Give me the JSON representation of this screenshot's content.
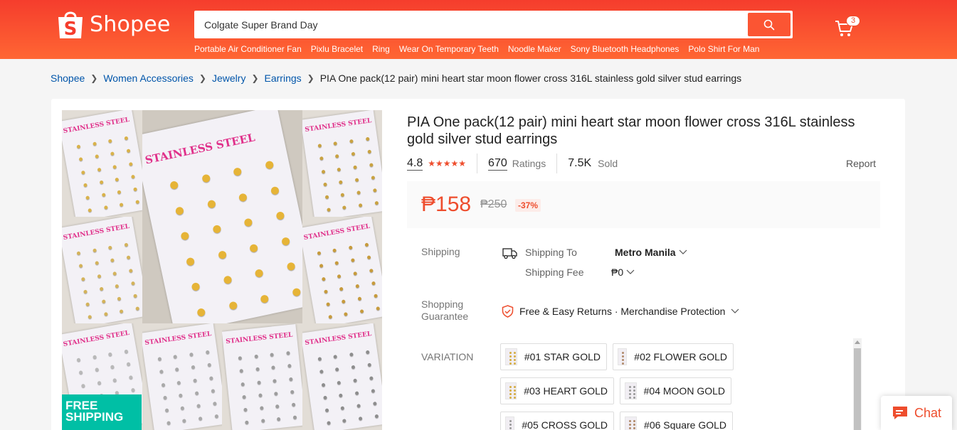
{
  "header": {
    "logo_text": "Shopee",
    "search_value": "Colgate Super Brand Day",
    "cart_count": "3",
    "suggestions": [
      "Portable Air Conditioner Fan",
      "Pixlu Bracelet",
      "Ring",
      "Wear On Temporary Teeth",
      "Noodle Maker",
      "Sony Bluetooth Headphones",
      "Polo Shirt For Man"
    ]
  },
  "breadcrumb": {
    "items": [
      "Shopee",
      "Women Accessories",
      "Jewelry",
      "Earrings"
    ],
    "current": "PIA One pack(12 pair) mini heart star moon flower cross 316L stainless gold silver stud earrings"
  },
  "gallery": {
    "board_label": "STAINLESS STEEL",
    "badge_line1": "FREE",
    "badge_line2": "SHIPPING"
  },
  "product": {
    "title": "PIA One pack(12 pair) mini heart star moon flower cross 316L stainless gold silver stud earrings",
    "rating": "4.8",
    "stars": 5,
    "ratings_count": "670",
    "ratings_label": "Ratings",
    "sold_count": "7.5K",
    "sold_label": "Sold",
    "report_label": "Report",
    "price": "₱158",
    "original_price": "₱250",
    "discount": "-37%"
  },
  "shipping": {
    "label": "Shipping",
    "to_label": "Shipping To",
    "to_value": "Metro Manila",
    "fee_label": "Shipping Fee",
    "fee_value": "₱0"
  },
  "guarantee": {
    "label_line1": "Shopping",
    "label_line2": "Guarantee",
    "text": "Free & Easy Returns · Merchandise Protection"
  },
  "variation": {
    "label": "VARIATION",
    "options": [
      "#01 STAR GOLD",
      "#02 FLOWER GOLD",
      "#03 HEART GOLD",
      "#04 MOON GOLD",
      "#05 CROSS GOLD",
      "#06 Square GOLD"
    ]
  },
  "chat_label": "Chat",
  "colors": {
    "brand": "#ee4d2d",
    "link": "#0055aa",
    "free_shipping": "#00bfa5"
  }
}
